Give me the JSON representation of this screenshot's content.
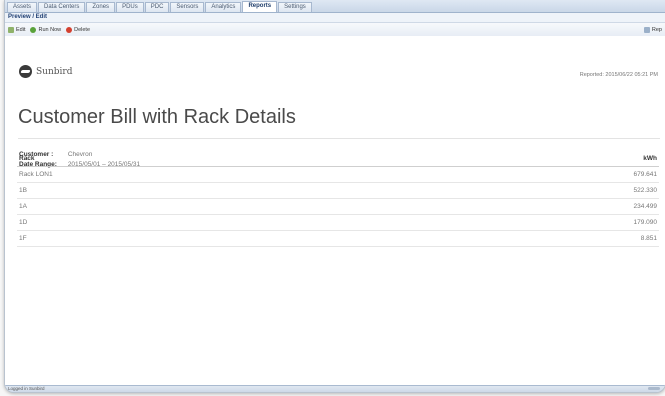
{
  "tabs": [
    {
      "label": "Assets"
    },
    {
      "label": "Data Centers"
    },
    {
      "label": "Zones"
    },
    {
      "label": "PDUs"
    },
    {
      "label": "PDC"
    },
    {
      "label": "Sensors"
    },
    {
      "label": "Analytics"
    },
    {
      "label": "Reports"
    },
    {
      "label": "Settings"
    }
  ],
  "section_title": "Preview / Edit",
  "toolbar": {
    "edit_label": "Edit",
    "run_now_label": "Run Now",
    "delete_label": "Delete",
    "report_label": "Rep"
  },
  "report": {
    "logo_text": "Sunbird",
    "reported_at": "Reported: 2015/06/22 05:21 PM",
    "title": "Customer Bill with Rack Details",
    "customer_label": "Customer :",
    "customer_value": "Chevron",
    "date_range_label": "Date Range:",
    "date_range_value": "2015/05/01 – 2015/05/31",
    "table": {
      "columns": [
        "Rack",
        "kWh"
      ],
      "rows": [
        {
          "rack": "Rack LON1",
          "kwh": "679.641"
        },
        {
          "rack": "1B",
          "kwh": "522.330"
        },
        {
          "rack": "1A",
          "kwh": "234.499"
        },
        {
          "rack": "1D",
          "kwh": "179.090"
        },
        {
          "rack": "1F",
          "kwh": "8.851"
        }
      ]
    }
  },
  "status_text": "Logged in Sunbird",
  "colors": {
    "tab_active_text": "#1e3d6b",
    "delete_icon": "#d4402f",
    "run_icon": "#5aa23a"
  }
}
